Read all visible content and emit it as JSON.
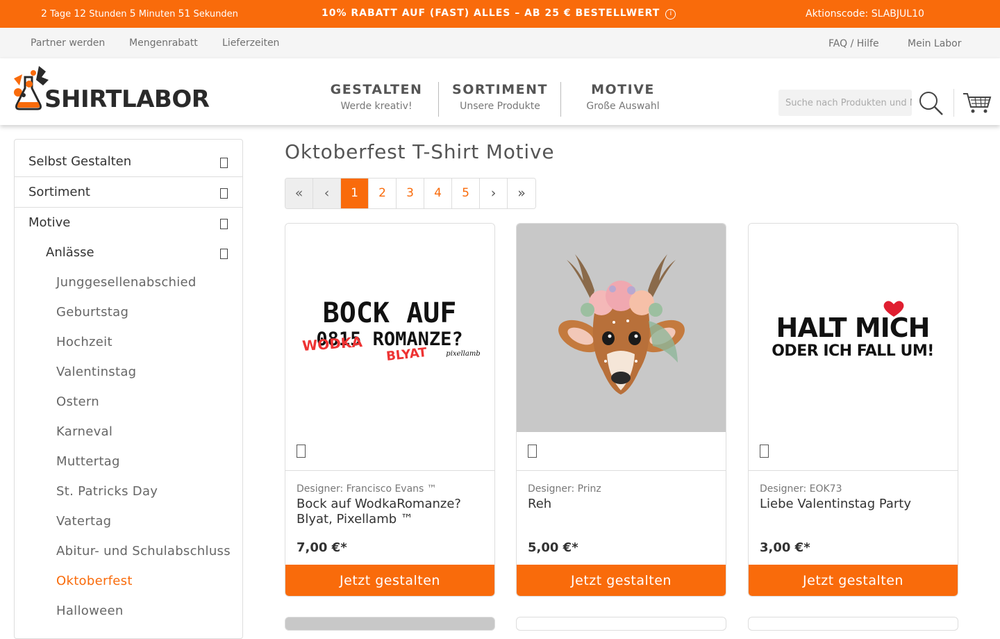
{
  "promo": {
    "countdown_days": "2",
    "countdown_days_lbl": "Tage",
    "countdown_hours": "12",
    "countdown_hours_lbl": "Stunden",
    "countdown_min": "5",
    "countdown_min_lbl": "Minuten",
    "countdown_sec": "51",
    "countdown_sec_lbl": "Sekunden",
    "deal": "10% RABATT AUF (FAST) ALLES – AB 25 € BESTELLWERT",
    "info_glyph": "i",
    "code": "Aktionscode: SLABJUL10"
  },
  "utility": {
    "partner": "Partner werden",
    "volume": "Mengenrabatt",
    "delivery": "Lieferzeiten",
    "faq": "FAQ / Hilfe",
    "account": "Mein Labor",
    "glyph": ""
  },
  "header": {
    "logo_text": "SHIRTLABOR",
    "nav": [
      {
        "title": "GESTALTEN",
        "sub": "Werde kreativ!"
      },
      {
        "title": "SORTIMENT",
        "sub": "Unsere Produkte"
      },
      {
        "title": "MOTIVE",
        "sub": "Große Auswahl"
      }
    ],
    "search_placeholder": "Suche nach Produkten und Motiven"
  },
  "sidebar": {
    "top": [
      "Selbst Gestalten",
      "Sortiment",
      "Motive"
    ],
    "anlaesse": "Anlässe",
    "items": [
      "Junggesellenabschied",
      "Geburtstag",
      "Hochzeit",
      "Valentinstag",
      "Ostern",
      "Karneval",
      "Muttertag",
      "St. Patricks Day",
      "Vatertag",
      "Abitur- und Schulabschluss",
      "Oktoberfest",
      "Halloween"
    ]
  },
  "main": {
    "title": "Oktoberfest T-Shirt Motive",
    "pager": {
      "first": "«",
      "prev": "‹",
      "pages": [
        "1",
        "2",
        "3",
        "4",
        "5"
      ],
      "next": "›",
      "last": "»"
    },
    "products": [
      {
        "designer": "Designer: Francisco Evans ™",
        "name": "Bock auf WodkaRomanze? Blyat, Pixellamb ™",
        "price": "7,00 €*",
        "cta": "Jetzt gestalten",
        "art": {
          "line1": "BOCK AUF",
          "line2": "0815 ROMANZE?",
          "overlay1": "WODKA",
          "overlay2": "BLYAT",
          "sig": "pixellamb"
        }
      },
      {
        "designer": "Designer: Prinz",
        "name": "Reh",
        "price": "5,00 €*",
        "cta": "Jetzt gestalten"
      },
      {
        "designer": "Designer: EOK73",
        "name": "Liebe Valentinstag Party",
        "price": "3,00 €*",
        "cta": "Jetzt gestalten",
        "art": {
          "line1": "HALT MICH",
          "line2": "ODER ICH FALL UM!"
        }
      }
    ]
  },
  "colors": {
    "accent": "#f96b0b",
    "border": "#dddddd"
  }
}
